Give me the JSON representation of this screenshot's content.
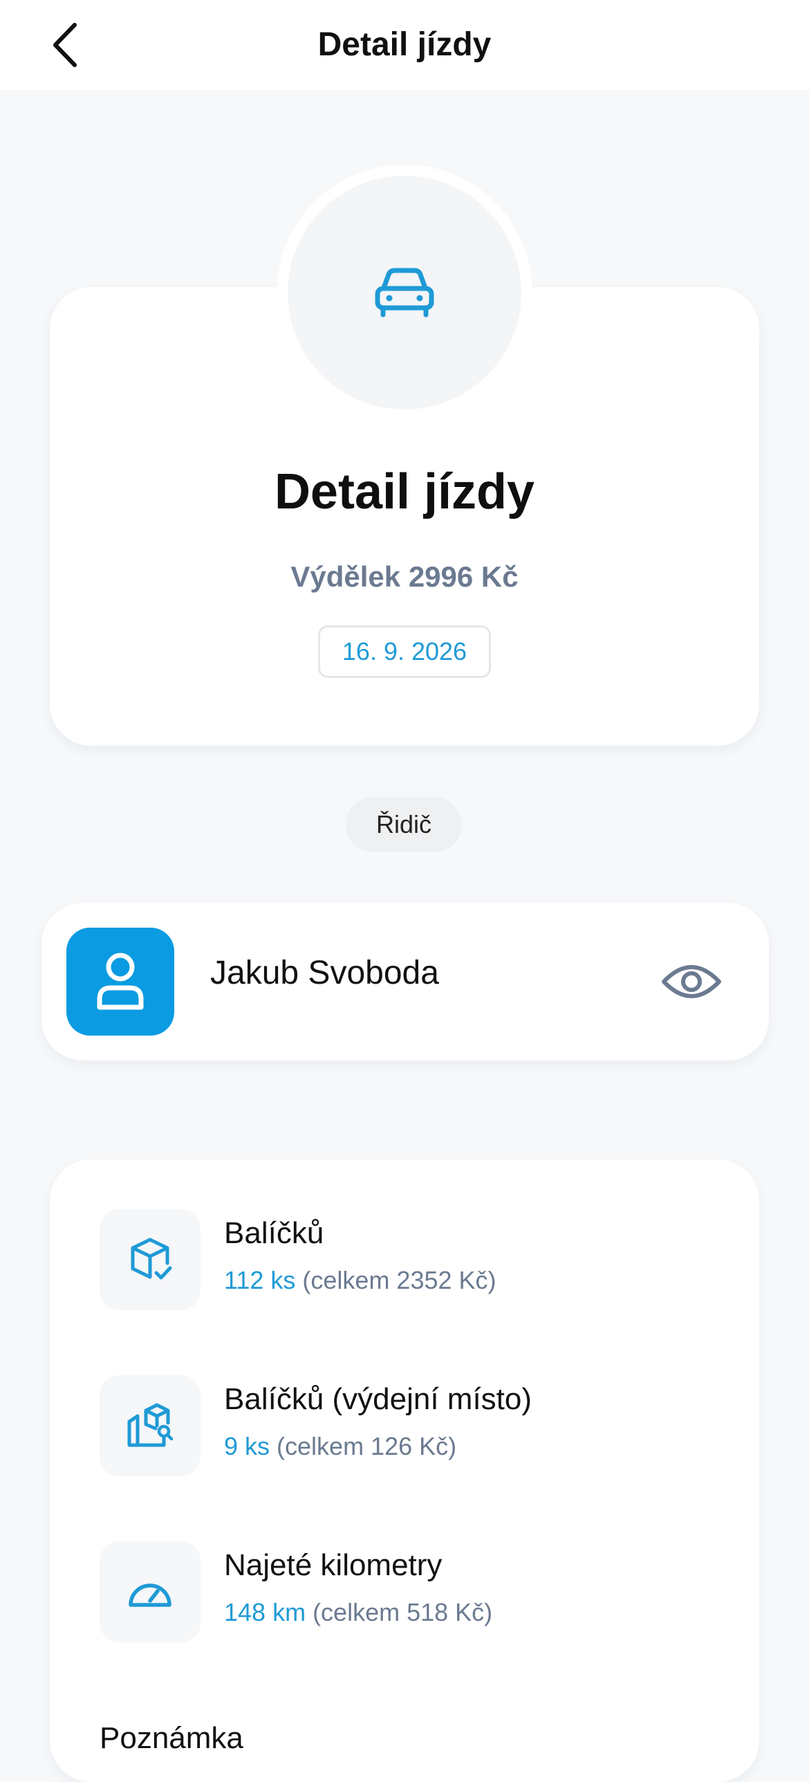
{
  "header": {
    "title": "Detail jízdy",
    "back_icon": "chevron-left-icon"
  },
  "hero": {
    "icon": "car-icon",
    "title": "Detail jízdy",
    "earning": "Výdělek 2996 Kč",
    "date": "16. 9. 2026"
  },
  "role": {
    "label": "Řidič"
  },
  "driver": {
    "name": "Jakub Svoboda",
    "avatar_icon": "user-icon",
    "view_icon": "eye-icon"
  },
  "stats": [
    {
      "title": "Balíčků",
      "value": "112 ks",
      "total": " (celkem 2352 Kč)",
      "icon": "package-check-icon"
    },
    {
      "title": "Balíčků (výdejní místo)",
      "value": "9 ks",
      "total": " (celkem 126 Kč)",
      "icon": "package-pickup-icon"
    },
    {
      "title": "Najeté kilometry",
      "value": "148 km",
      "total": " (celkem 518 Kč)",
      "icon": "speedometer-icon"
    }
  ],
  "note": {
    "title": "Poznámka"
  },
  "colors": {
    "accent": "#1f9ad6",
    "avatar_bg": "#0a9be2",
    "muted": "#6b7a90",
    "background": "#f6f8fa"
  }
}
